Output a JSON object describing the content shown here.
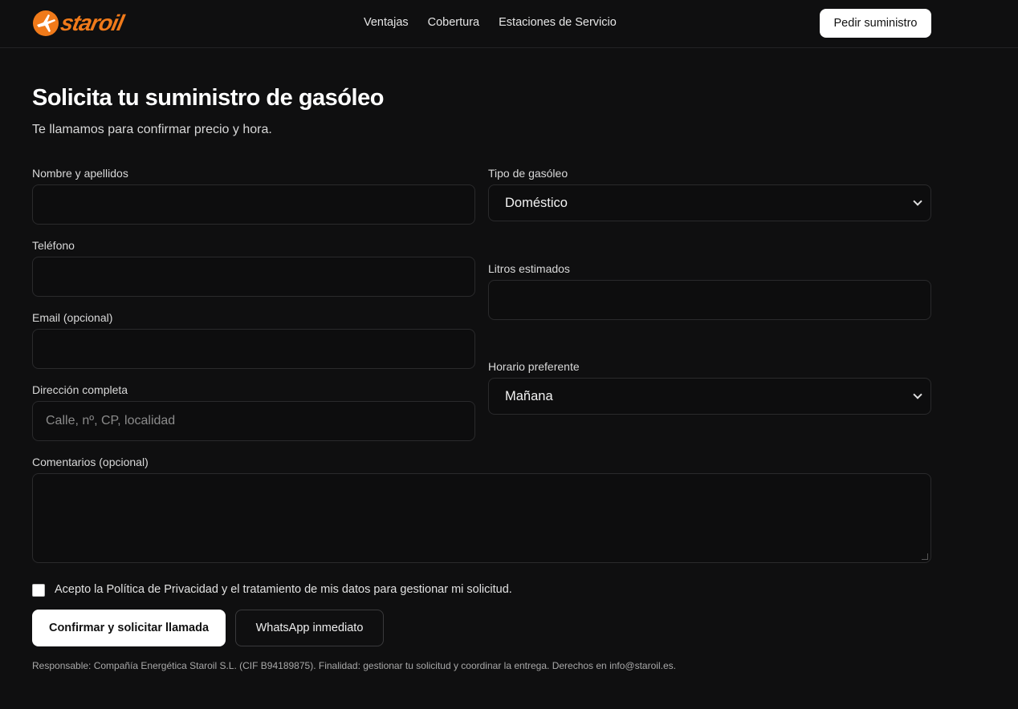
{
  "brand": {
    "name": "staroil",
    "accent_color": "#f07a1a",
    "logo_icon": "star-plane-icon"
  },
  "nav": {
    "items": [
      "Ventajas",
      "Cobertura",
      "Estaciones de Servicio"
    ],
    "cta": "Pedir suministro"
  },
  "page": {
    "title": "Solicita tu suministro de gasóleo",
    "subtitle": "Te llamamos para confirmar precio y hora."
  },
  "form": {
    "name": {
      "label": "Nombre y apellidos",
      "value": "",
      "placeholder": ""
    },
    "phone": {
      "label": "Teléfono",
      "value": "",
      "placeholder": ""
    },
    "email": {
      "label": "Email (opcional)",
      "value": "",
      "placeholder": ""
    },
    "address": {
      "label": "Dirección completa",
      "value": "",
      "placeholder": "Calle, nº, CP, localidad"
    },
    "fuel_type": {
      "label": "Tipo de gasóleo",
      "selected": "Doméstico"
    },
    "liters": {
      "label": "Litros estimados",
      "value": "",
      "placeholder": ""
    },
    "schedule": {
      "label": "Horario preferente",
      "selected": "Mañana"
    },
    "comments": {
      "label": "Comentarios (opcional)",
      "value": "",
      "placeholder": ""
    },
    "consent": "Acepto la Política de Privacidad y el tratamiento de mis datos para gestionar mi solicitud.",
    "submit": "Confirmar y solicitar llamada",
    "whatsapp": "WhatsApp inmediato"
  },
  "legal": "Responsable: Compañía Energética Staroil S.L. (CIF B94189875). Finalidad: gestionar tu solicitud y coordinar la entrega. Derechos en info@staroil.es."
}
